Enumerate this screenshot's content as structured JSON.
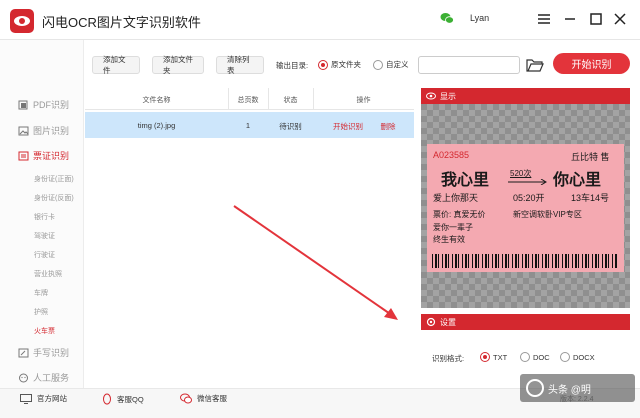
{
  "app": {
    "title": "闪电OCR图片文字识别软件",
    "user": "Lyan"
  },
  "sidebar": {
    "items": [
      {
        "label": "PDF识别"
      },
      {
        "label": "图片识别"
      },
      {
        "label": "票证识别"
      },
      {
        "label": "手写识别"
      },
      {
        "label": "人工服务"
      }
    ],
    "subitems": [
      "身份证(正面)",
      "身份证(反面)",
      "银行卡",
      "驾驶证",
      "行驶证",
      "营业执照",
      "车牌",
      "护照",
      "火车票"
    ]
  },
  "toolbar": {
    "add_file": "添加文件",
    "add_folder": "添加文件夹",
    "clear_list": "清除列表",
    "output_label": "输出目录:",
    "opt_source": "原文件夹",
    "opt_custom": "自定义",
    "start": "开始识别"
  },
  "table": {
    "headers": [
      "文件名称",
      "总页数",
      "状态",
      "操作"
    ],
    "row": {
      "name": "timg (2).jpg",
      "pages": "1",
      "status": "待识别",
      "start": "开始识别",
      "delete": "删除"
    }
  },
  "preview": {
    "title": "显示",
    "ticket": {
      "code": "A023585",
      "office": "丘比特 售",
      "from": "我心里",
      "train": "520次",
      "to": "你心里",
      "date_line": "爱上你那天",
      "time": "05:20开",
      "seat": "13车14号",
      "price_line": "票价: 真爱无价",
      "class": "新空调软卧VIP专区",
      "line3": "爱你一辈子",
      "line4": "终生有效"
    }
  },
  "settings": {
    "title": "设置",
    "format_label": "识别格式:",
    "formats": [
      "TXT",
      "DOC",
      "DOCX"
    ]
  },
  "footer": {
    "website": "官方网站",
    "qq": "客服QQ",
    "wechat": "微信客服",
    "version": "版本: 2.2.4"
  },
  "watermark": "头条 @明"
}
